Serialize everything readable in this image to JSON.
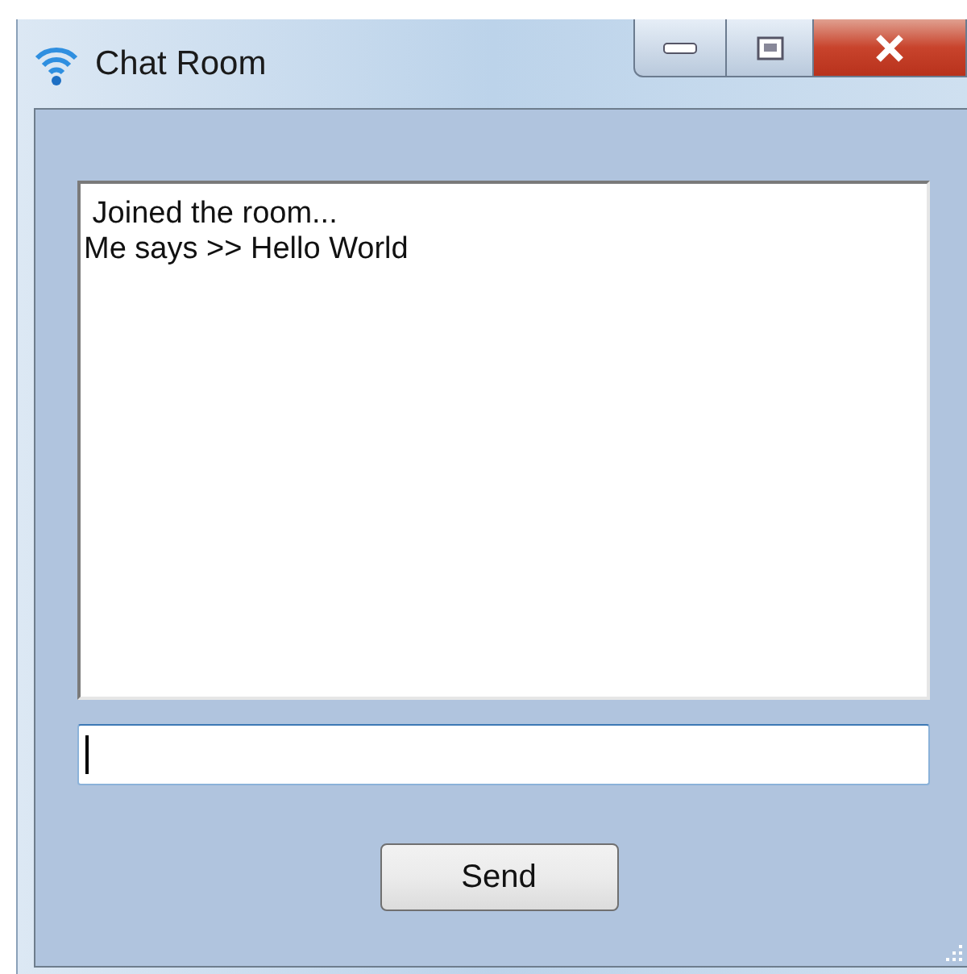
{
  "window": {
    "title": "Chat Room"
  },
  "messages": [
    " Joined the room...",
    "Me says >> Hello World"
  ],
  "buttons": [
    {
      "label": "Send"
    }
  ]
}
